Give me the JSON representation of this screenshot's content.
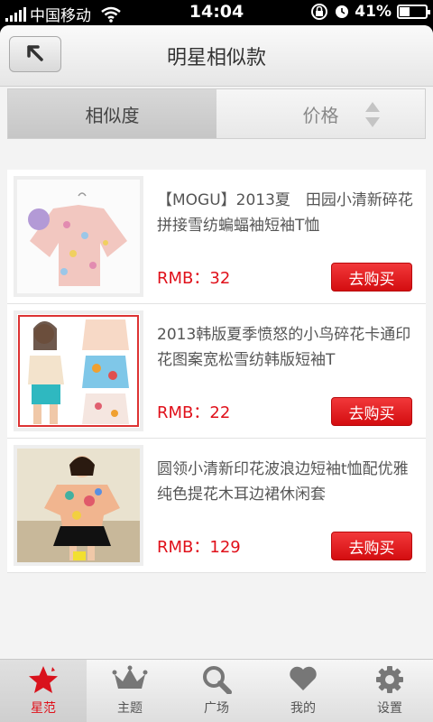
{
  "status": {
    "carrier": "中国移动",
    "time": "14:04",
    "battery": "41%",
    "battery_level": 0.41
  },
  "header": {
    "title": "明星相似款",
    "back_icon": "back-arrow-icon"
  },
  "sort": {
    "tabs": [
      "相似度",
      "价格"
    ],
    "active_index": 0
  },
  "items": [
    {
      "title": "【MOGU】2013夏　田园小清新碎花拼接雪纺蝙蝠袖短袖T恤",
      "price": "RMB：32",
      "buy_label": "去购买"
    },
    {
      "title": "2013韩版夏季愤怒的小鸟碎花卡通印花图案宽松雪纺韩版短袖T",
      "price": "RMB：22",
      "buy_label": "去购买"
    },
    {
      "title": "圆领小清新印花波浪边短袖t恤配优雅纯色提花木耳边裙休闲套",
      "price": "RMB：129",
      "buy_label": "去购买"
    }
  ],
  "tabbar": {
    "items": [
      {
        "label": "星范",
        "icon": "star-icon"
      },
      {
        "label": "主题",
        "icon": "crown-icon"
      },
      {
        "label": "广场",
        "icon": "search-icon"
      },
      {
        "label": "我的",
        "icon": "heart-icon"
      },
      {
        "label": "设置",
        "icon": "gear-icon"
      }
    ],
    "active_index": 0
  },
  "colors": {
    "accent": "#e0101a"
  }
}
